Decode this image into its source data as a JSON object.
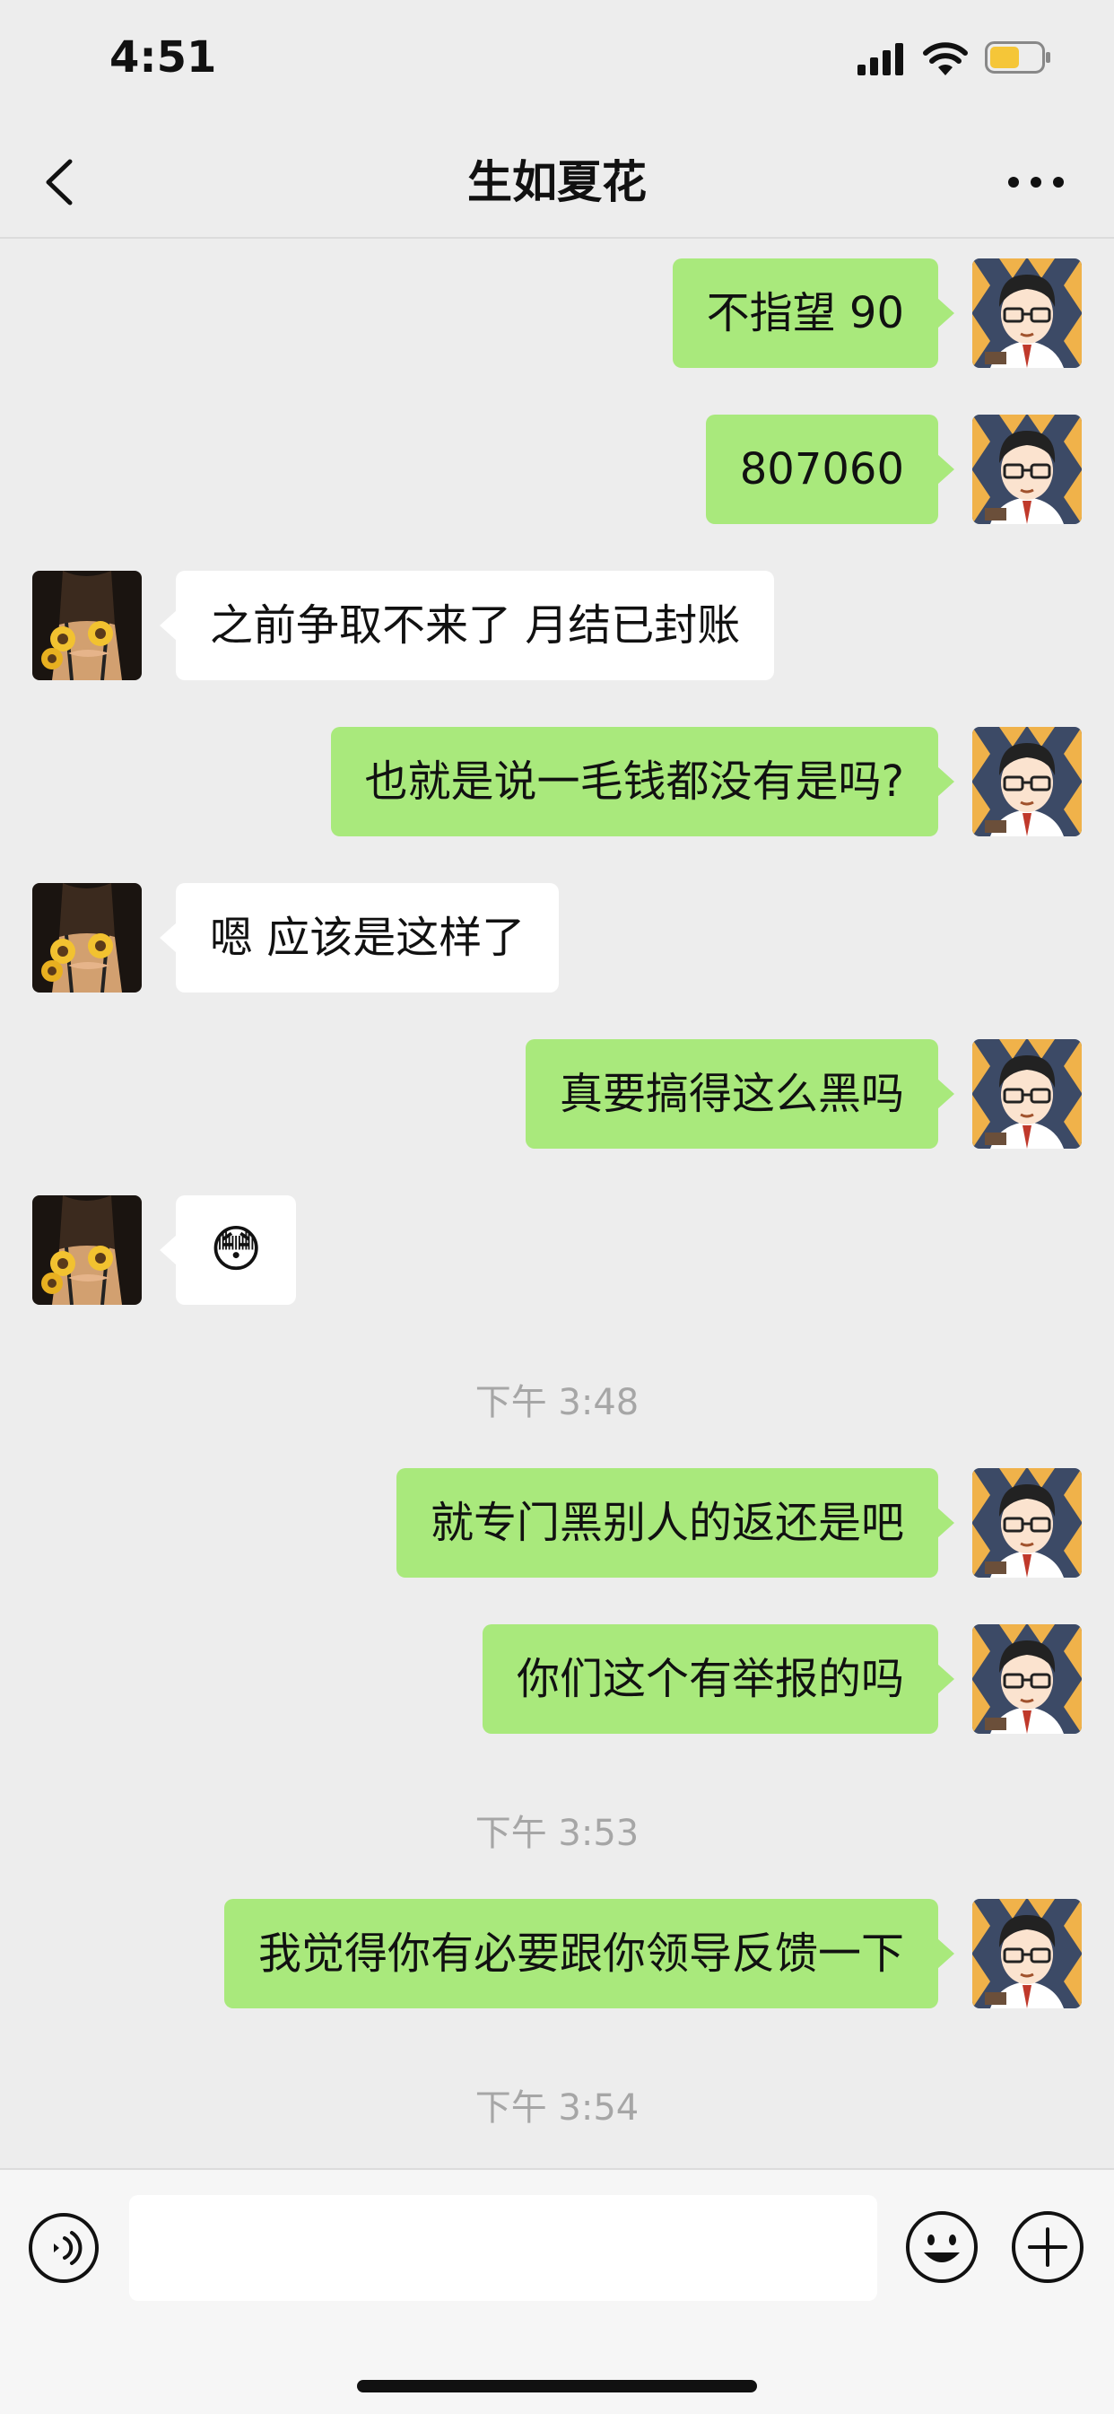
{
  "status_bar": {
    "time": "4:51"
  },
  "nav": {
    "title": "生如夏花"
  },
  "messages": [
    {
      "side": "out",
      "text": "不指望 90"
    },
    {
      "side": "out",
      "text": "807060"
    },
    {
      "side": "in",
      "text": "之前争取不来了 月结已封账"
    },
    {
      "side": "out",
      "text": "也就是说一毛钱都没有是吗?"
    },
    {
      "side": "in",
      "text": "嗯 应该是这样了"
    },
    {
      "side": "out",
      "text": "真要搞得这么黑吗"
    },
    {
      "side": "in",
      "text": "😳"
    },
    {
      "side": "out",
      "text": "就专门黑别人的返还是吧"
    },
    {
      "side": "out",
      "text": "你们这个有举报的吗"
    },
    {
      "side": "out",
      "text": "我觉得你有必要跟你领导反馈一下"
    }
  ],
  "timestamps": [
    "下午 3:48",
    "下午 3:53",
    "下午 3:54"
  ],
  "input": {
    "value": "",
    "placeholder": ""
  },
  "colors": {
    "outgoing_bubble": "#a9e97c",
    "incoming_bubble": "#ffffff",
    "background": "#ededed"
  }
}
